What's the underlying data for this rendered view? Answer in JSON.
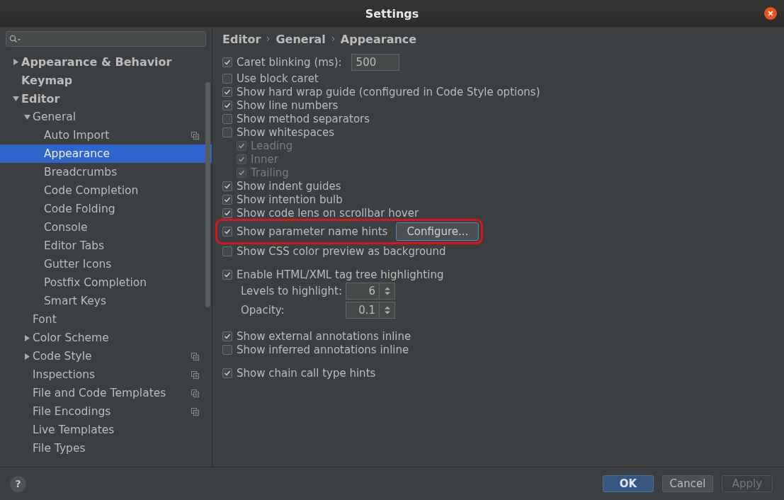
{
  "window": {
    "title": "Settings"
  },
  "sidebar": {
    "tree": [
      {
        "label": "Appearance & Behavior",
        "expanded": false,
        "selected": false,
        "project_scope": false
      },
      {
        "label": "Keymap",
        "selected": false,
        "project_scope": false
      },
      {
        "label": "Editor",
        "expanded": true,
        "selected": false,
        "project_scope": false,
        "children": [
          {
            "label": "General",
            "expanded": true,
            "selected": false,
            "project_scope": false,
            "children": [
              {
                "label": "Auto Import",
                "selected": false,
                "project_scope": true
              },
              {
                "label": "Appearance",
                "selected": true,
                "project_scope": false
              },
              {
                "label": "Breadcrumbs",
                "selected": false,
                "project_scope": false
              },
              {
                "label": "Code Completion",
                "selected": false,
                "project_scope": false
              },
              {
                "label": "Code Folding",
                "selected": false,
                "project_scope": false
              },
              {
                "label": "Console",
                "selected": false,
                "project_scope": false
              },
              {
                "label": "Editor Tabs",
                "selected": false,
                "project_scope": false
              },
              {
                "label": "Gutter Icons",
                "selected": false,
                "project_scope": false
              },
              {
                "label": "Postfix Completion",
                "selected": false,
                "project_scope": false
              },
              {
                "label": "Smart Keys",
                "selected": false,
                "project_scope": false
              }
            ]
          },
          {
            "label": "Font",
            "selected": false,
            "project_scope": false
          },
          {
            "label": "Color Scheme",
            "expanded": false,
            "selected": false,
            "project_scope": false
          },
          {
            "label": "Code Style",
            "expanded": false,
            "selected": false,
            "project_scope": true
          },
          {
            "label": "Inspections",
            "selected": false,
            "project_scope": true
          },
          {
            "label": "File and Code Templates",
            "selected": false,
            "project_scope": true
          },
          {
            "label": "File Encodings",
            "selected": false,
            "project_scope": true
          },
          {
            "label": "Live Templates",
            "selected": false,
            "project_scope": false
          },
          {
            "label": "File Types",
            "selected": false,
            "project_scope": false
          }
        ]
      }
    ]
  },
  "breadcrumb": [
    "Editor",
    "General",
    "Appearance"
  ],
  "groups": [
    {
      "options": [
        {
          "kind": "checkbox-field",
          "label": "Caret blinking (ms):",
          "checked": true,
          "disabled": false,
          "value": "500"
        },
        {
          "kind": "checkbox",
          "label": "Use block caret",
          "checked": false,
          "disabled": false
        },
        {
          "kind": "checkbox",
          "label": "Show hard wrap guide (configured in Code Style options)",
          "checked": true,
          "disabled": false
        },
        {
          "kind": "checkbox",
          "label": "Show line numbers",
          "checked": true,
          "disabled": false
        },
        {
          "kind": "checkbox",
          "label": "Show method separators",
          "checked": false,
          "disabled": false
        },
        {
          "kind": "checkbox",
          "label": "Show whitespaces",
          "checked": false,
          "disabled": false,
          "children": [
            {
              "kind": "checkbox",
              "label": "Leading",
              "checked": true,
              "disabled": true
            },
            {
              "kind": "checkbox",
              "label": "Inner",
              "checked": true,
              "disabled": true
            },
            {
              "kind": "checkbox",
              "label": "Trailing",
              "checked": true,
              "disabled": true
            }
          ]
        },
        {
          "kind": "checkbox",
          "label": "Show indent guides",
          "checked": true,
          "disabled": false
        },
        {
          "kind": "checkbox",
          "label": "Show intention bulb",
          "checked": true,
          "disabled": false
        },
        {
          "kind": "checkbox",
          "label": "Show code lens on scrollbar hover",
          "checked": true,
          "disabled": false
        },
        {
          "kind": "checkbox-button",
          "label": "Show parameter name hints",
          "checked": true,
          "disabled": false,
          "button": "Configure...",
          "highlighted": true
        },
        {
          "kind": "checkbox",
          "label": "Show CSS color preview as background",
          "checked": false,
          "disabled": false
        }
      ]
    },
    {
      "options": [
        {
          "kind": "checkbox",
          "label": "Enable HTML/XML tag tree highlighting",
          "checked": true,
          "disabled": false
        },
        {
          "kind": "spinner",
          "label": "Levels to highlight:",
          "value": "6"
        },
        {
          "kind": "spinner",
          "label": "Opacity:",
          "value": "0.1"
        }
      ]
    },
    {
      "options": [
        {
          "kind": "checkbox",
          "label": "Show external annotations inline",
          "checked": true,
          "disabled": false
        },
        {
          "kind": "checkbox",
          "label": "Show inferred annotations inline",
          "checked": false,
          "disabled": false
        }
      ]
    },
    {
      "options": [
        {
          "kind": "checkbox",
          "label": "Show chain call type hints",
          "checked": true,
          "disabled": false
        }
      ]
    }
  ],
  "footer": {
    "help": "?",
    "buttons": [
      {
        "label": "OK",
        "default": true,
        "disabled": false
      },
      {
        "label": "Cancel",
        "default": false,
        "disabled": false
      },
      {
        "label": "Apply",
        "default": false,
        "disabled": true
      }
    ]
  }
}
